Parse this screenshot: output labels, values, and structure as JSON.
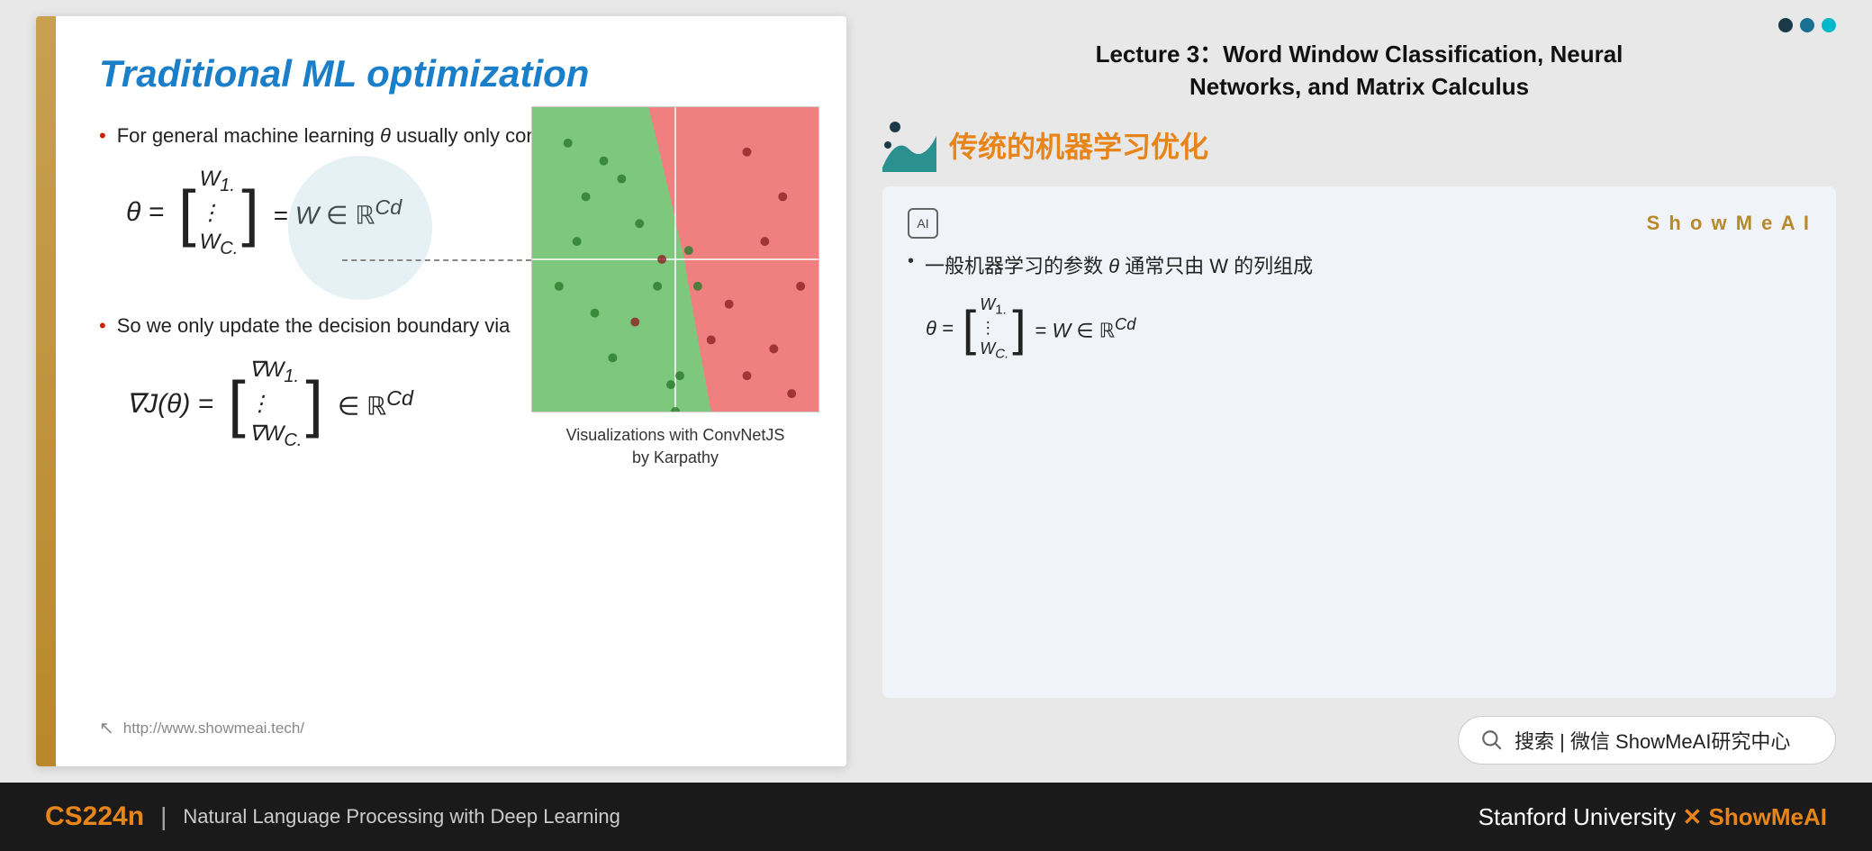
{
  "lecture": {
    "title_line1": "Lecture 3：Word Window Classification, Neural",
    "title_line2": "Networks, and Matrix Calculus",
    "subtitle_cn": "传统的机器学习优化"
  },
  "slide": {
    "title": "Traditional ML optimization",
    "bullet1_text_before": "For general machine learning ",
    "bullet1_theta": "θ",
    "bullet1_text_after": " usually only consists of columns of W:",
    "bullet1_highlight": "W",
    "bullet2_text": "So we only update the decision boundary via",
    "formula_theta": "θ =",
    "formula_W_set": "= W ∈ ℝ",
    "formula_Cd": "Cd",
    "formula_grad": "∇J(θ) =",
    "formula_grad_set": "∈ ℝ",
    "matrix_rows": [
      "W₁.",
      "⋮",
      "Wc."
    ],
    "grad_matrix_rows": [
      "∇W₁.",
      "⋮",
      "∇Wc."
    ],
    "vis_caption": "Visualizations with ConvNetJS by Karpathy",
    "footer_url": "http://www.showmeai.tech/"
  },
  "translation_card": {
    "brand": "S h o w M e A I",
    "ai_icon": "AI",
    "bullet_cn": "一般机器学习的参数 θ 通常只由 W 的列组成",
    "theta_label": "θ =",
    "equals_W": "= W ∈ ℝ",
    "superscript": "Cd",
    "cn_matrix_rows": [
      "W₁.",
      "⋮",
      "Wc."
    ]
  },
  "search": {
    "placeholder": "搜索 | 微信 ShowMeAI研究中心"
  },
  "footer": {
    "course_code": "CS224n",
    "divider": "|",
    "description": "Natural Language Processing with Deep Learning",
    "university": "Stanford University",
    "x_mark": "✕",
    "brand": "ShowMeAI"
  },
  "dots": [
    {
      "color": "#1a3a4a"
    },
    {
      "color": "#1a7090"
    },
    {
      "color": "#00b8c8"
    }
  ]
}
